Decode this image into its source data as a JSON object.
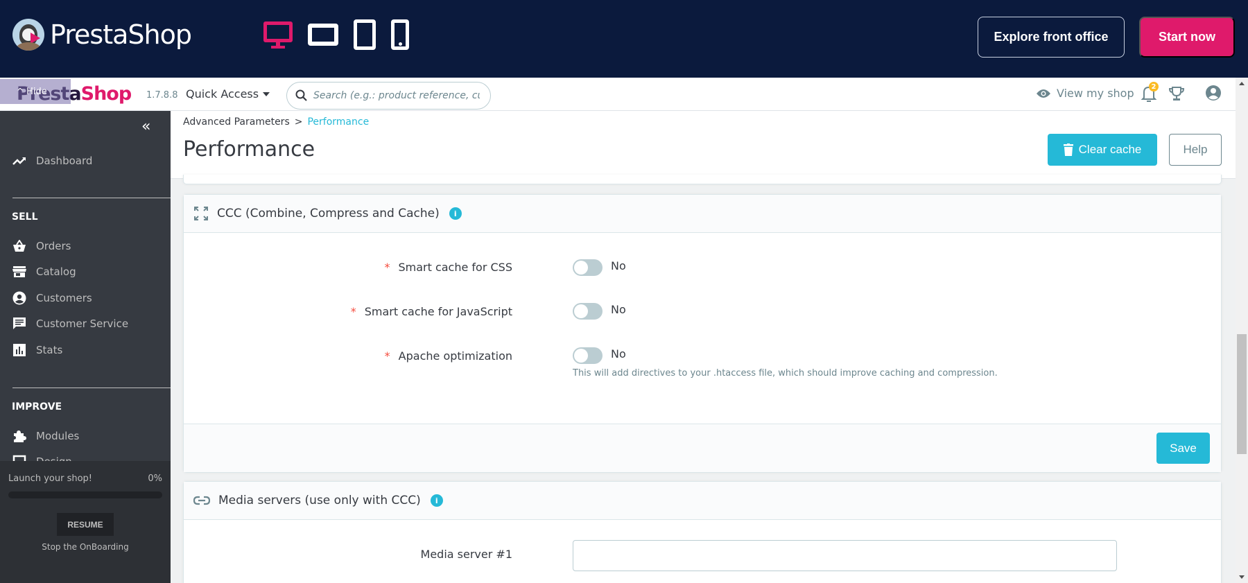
{
  "preview_bar": {
    "brand": "PrestaShop",
    "devices": [
      {
        "name": "desktop",
        "active": true
      },
      {
        "name": "tablet-landscape",
        "active": false
      },
      {
        "name": "tablet-portrait",
        "active": false
      },
      {
        "name": "mobile",
        "active": false
      }
    ],
    "explore_label": "Explore front office",
    "start_label": "Start now",
    "colors": {
      "background": "#0b1a3d",
      "accent": "#df1a6b"
    }
  },
  "header": {
    "hide_label": "Hide",
    "logo_part1": "Presta",
    "logo_part2": "Shop",
    "version": "1.7.8.8",
    "quick_access": "Quick Access",
    "search_placeholder": "Search (e.g.: product reference, custon",
    "view_shop": "View my shop",
    "notifications_count": "2"
  },
  "sidebar": {
    "dashboard": "Dashboard",
    "sections": [
      {
        "title": "SELL",
        "items": [
          "Orders",
          "Catalog",
          "Customers",
          "Customer Service",
          "Stats"
        ]
      },
      {
        "title": "IMPROVE",
        "items": [
          "Modules",
          "Design"
        ]
      }
    ],
    "onboarding": {
      "label": "Launch your shop!",
      "percent_text": "0%",
      "progress": 0,
      "resume": "RESUME",
      "stop": "Stop the OnBoarding"
    }
  },
  "page": {
    "breadcrumb": [
      "Advanced Parameters",
      "Performance"
    ],
    "title": "Performance",
    "clear_cache": "Clear cache",
    "help": "Help"
  },
  "ccc_panel": {
    "title": "CCC (Combine, Compress and Cache)",
    "fields": [
      {
        "label": "Smart cache for CSS",
        "required": true,
        "value": "No",
        "enabled": false
      },
      {
        "label": "Smart cache for JavaScript",
        "required": true,
        "value": "No",
        "enabled": false
      },
      {
        "label": "Apache optimization",
        "required": true,
        "value": "No",
        "enabled": false,
        "help": "This will add directives to your .htaccess file, which should improve caching and compression."
      }
    ],
    "save": "Save"
  },
  "media_panel": {
    "title": "Media servers (use only with CCC)",
    "fields": [
      {
        "label": "Media server #1",
        "value": ""
      }
    ]
  }
}
